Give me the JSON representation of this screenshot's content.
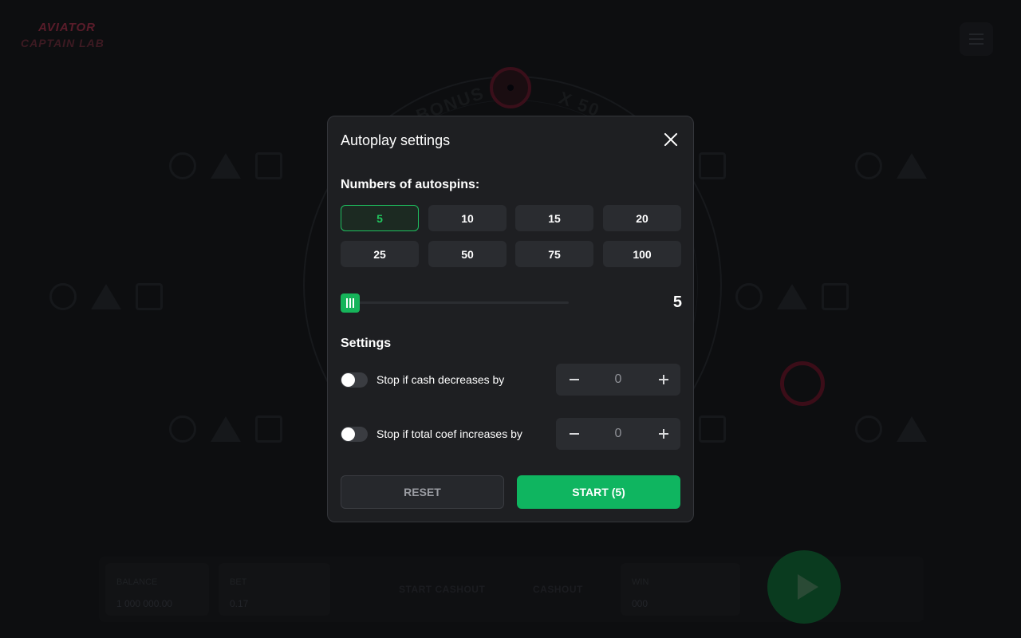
{
  "background": {
    "logo": {
      "line1": "AVIATOR",
      "line2": "CAPTAIN LAB"
    },
    "wheel_words": [
      "BONUS",
      "X 50"
    ],
    "bottom_bar": {
      "balance_label": "BALANCE",
      "balance_value": "1 000 000.00",
      "bet_label": "BET",
      "bet_value": "0.17",
      "btn_start_cashout": "START CASHOUT",
      "btn_cashout": "CASHOUT",
      "win_label": "WIN",
      "win_value": "000"
    }
  },
  "modal": {
    "title": "Autoplay settings",
    "autospins_label": "Numbers of autospins:",
    "spin_options": [
      "5",
      "10",
      "15",
      "20",
      "25",
      "50",
      "75",
      "100"
    ],
    "selected_option": "5",
    "slider": {
      "value": "5",
      "level": 0.0
    },
    "settings_label": "Settings",
    "rules": [
      {
        "label": "Stop if cash decreases by",
        "enabled": false,
        "value": "0"
      },
      {
        "label": "Stop if total coef increases by",
        "enabled": false,
        "value": "0"
      }
    ],
    "reset_label": "RESET",
    "start_label": "START (5)"
  },
  "colors": {
    "accent_green": "#0fb560",
    "modal_bg": "#1e1f22",
    "page_bg": "#0d0e10"
  },
  "icons": {
    "close": "close-icon",
    "slider_grip": "grip-icon",
    "minus": "minus-icon",
    "plus": "plus-icon"
  }
}
